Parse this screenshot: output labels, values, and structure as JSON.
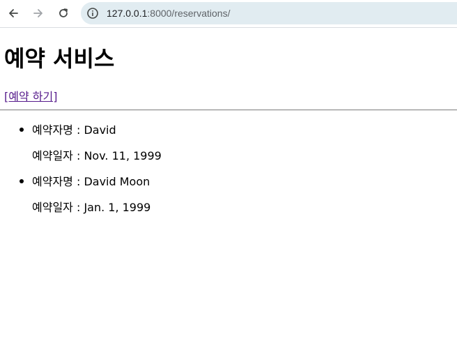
{
  "browser": {
    "url_host": "127.0.0.1",
    "url_rest": ":8000/reservations/"
  },
  "page": {
    "title": "예약 서비스",
    "reserve_link": "[예약 하기]"
  },
  "reservations": [
    {
      "name_label": "예약자명 : David",
      "date_label": "예약일자 : Nov. 11, 1999"
    },
    {
      "name_label": "예약자명 : David Moon",
      "date_label": "예약일자 : Jan. 1, 1999"
    }
  ]
}
